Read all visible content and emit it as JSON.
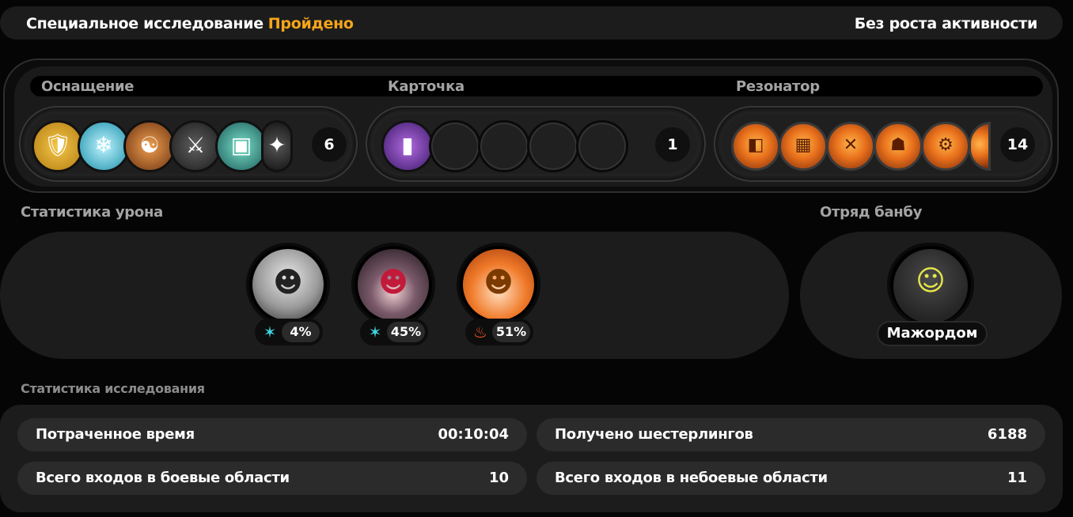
{
  "header": {
    "title": "Специальное исследование",
    "status": "Пройдено",
    "status_color": "#f6a51a",
    "right_text": "Без роста активности"
  },
  "loadout": {
    "equipment": {
      "label": "Оснащение",
      "count": "6",
      "icons": [
        "gold-shield-icon",
        "ice-claw-icon",
        "yin-yang-icon",
        "dark-horn-icon",
        "battery-pack-icon",
        "blade-icon"
      ]
    },
    "card": {
      "label": "Карточка",
      "count": "1",
      "icons": [
        "purple-card-icon"
      ]
    },
    "resonator": {
      "label": "Резонатор",
      "count": "14",
      "icons": [
        "fire-disk-icon",
        "fire-grid-icon",
        "fire-cross-icon",
        "zone-robot-icon",
        "zone-gear-icon",
        "zone-partial-icon"
      ]
    }
  },
  "damage_stats": {
    "label": "Статистика урона",
    "agents": [
      {
        "name": "agent-1",
        "element": "ice-star-icon",
        "element_color": "#3fd3e0",
        "percent": "4%"
      },
      {
        "name": "agent-2",
        "element": "ice-star-icon",
        "element_color": "#3fd3e0",
        "percent": "45%"
      },
      {
        "name": "agent-3",
        "element": "fire-icon",
        "element_color": "#ff5a1e",
        "percent": "51%"
      }
    ]
  },
  "bangboo": {
    "label": "Отряд банбу",
    "name": "Мажордом"
  },
  "exploration": {
    "label": "Статистика исследования",
    "rows": [
      {
        "key": "Потраченное время",
        "value": "00:10:04"
      },
      {
        "key": "Получено шестерлингов",
        "value": "6188"
      },
      {
        "key": "Всего входов в боевые области",
        "value": "10"
      },
      {
        "key": "Всего входов в небоевые области",
        "value": "11"
      }
    ]
  }
}
